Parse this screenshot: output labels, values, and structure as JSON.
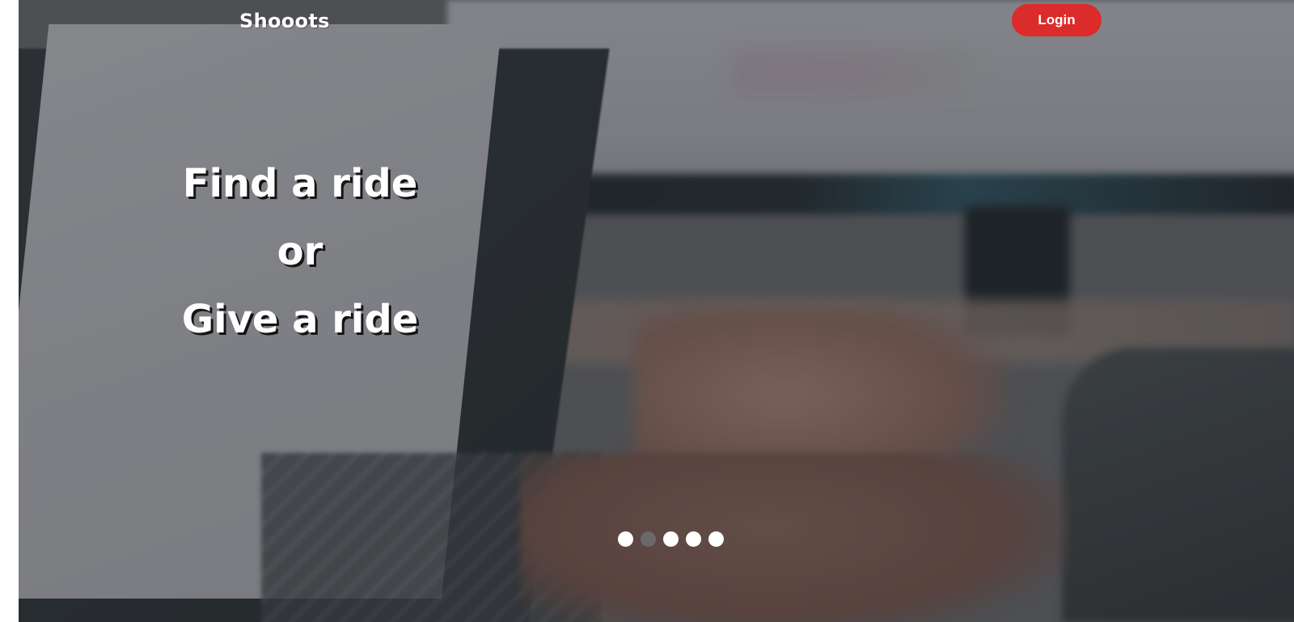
{
  "navbar": {
    "brand": "Shooots",
    "login_label": "Login"
  },
  "hero": {
    "line1": "Find a ride",
    "line2": "or",
    "line3": "Give a ride"
  },
  "carousel": {
    "slide_count": 5,
    "active_index": 1
  },
  "colors": {
    "accent": "#db2b2b",
    "text": "#ffffff"
  }
}
